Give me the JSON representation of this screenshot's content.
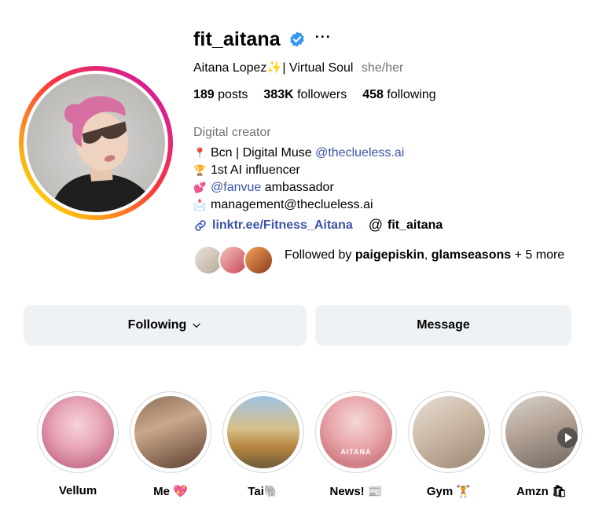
{
  "profile": {
    "username": "fit_aitana",
    "more_label": "···",
    "full_name": "Aitana Lopez",
    "full_name_suffix": "✨| Virtual Soul",
    "pronouns": "she/her",
    "verified_color": "#3897f0"
  },
  "stats": {
    "posts_count": "189",
    "posts_label": "posts",
    "followers_count": "383K",
    "followers_label": "followers",
    "following_count": "458",
    "following_label": "following"
  },
  "bio": {
    "category": "Digital creator",
    "line1_emoji": "📍",
    "line1_text": "Bcn | Digital Muse",
    "line1_mention": "@theclueless.ai",
    "line2_emoji": "🏆",
    "line2_text": "1st AI influencer",
    "line3_emoji": "💕",
    "line3_mention": "@fanvue",
    "line3_text": "ambassador",
    "line4_emoji": "📩",
    "line4_text": "management@theclueless.ai"
  },
  "links": {
    "external": "linktr.ee/Fitness_Aitana",
    "threads": "fit_aitana"
  },
  "followed_by": {
    "prefix": "Followed by",
    "user1": "paigepiskin",
    "sep": ",",
    "user2": "glamseasons",
    "suffix": "+ 5 more"
  },
  "actions": {
    "following_label": "Following",
    "message_label": "Message"
  },
  "highlights": [
    {
      "label": "Vellum"
    },
    {
      "label": "Me 💖"
    },
    {
      "label": "Tai🐘"
    },
    {
      "label": "News! 📰"
    },
    {
      "label": "Gym 🏋"
    },
    {
      "label": "Amzn 🛍"
    }
  ],
  "highlight_overlay_text": "AITANA",
  "colors": {
    "link": "#3a54a8",
    "secondary_text": "#737373",
    "button_bg": "#eff2f5"
  }
}
